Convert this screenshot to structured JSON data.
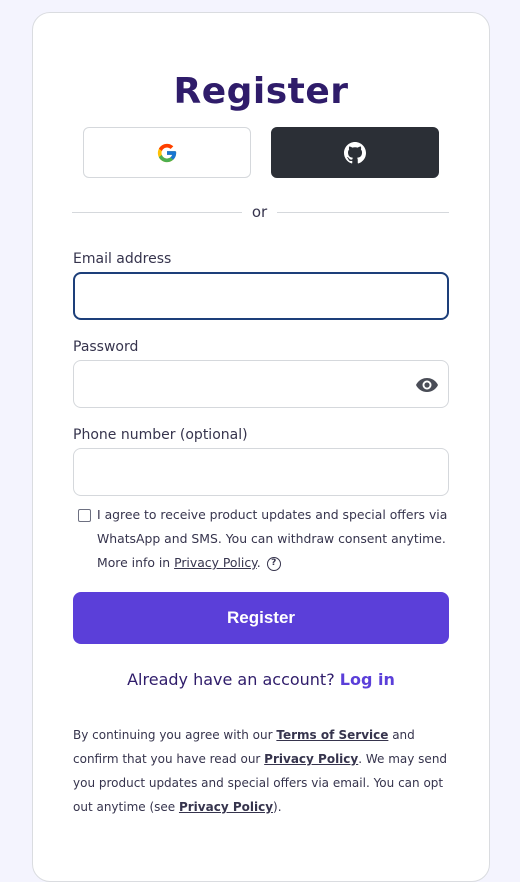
{
  "title": "Register",
  "social": {
    "google_icon": "google-icon",
    "github_icon": "github-icon"
  },
  "divider_text": "or",
  "fields": {
    "email": {
      "label": "Email address",
      "value": "",
      "placeholder": ""
    },
    "password": {
      "label": "Password",
      "value": "",
      "placeholder": "",
      "toggle_icon": "eye-icon"
    },
    "phone": {
      "label": "Phone number (optional)",
      "value": "",
      "placeholder": ""
    }
  },
  "consent": {
    "checked": false,
    "text_before": "I agree to receive product updates and special offers via WhatsApp and SMS. You can withdraw consent anytime. More info in ",
    "link": "Privacy Policy",
    "text_after": ".",
    "help_glyph": "?"
  },
  "register_button": "Register",
  "login": {
    "prompt": "Already have an account?",
    "link": "Log in"
  },
  "legal": {
    "part1": "By continuing you agree with our ",
    "terms_link": "Terms of Service",
    "part2": " and confirm that you have read our ",
    "privacy_link_1": "Privacy Policy",
    "part3": ". We may send you product updates and special offers via email. You can opt out anytime (see ",
    "privacy_link_2": "Privacy Policy",
    "part4": ")."
  },
  "colors": {
    "background": "#f4f4fe",
    "title": "#2f1c6a",
    "accent": "#5b3fd9",
    "github_button": "#2b2f36",
    "focus_border": "#1d3f7a"
  }
}
